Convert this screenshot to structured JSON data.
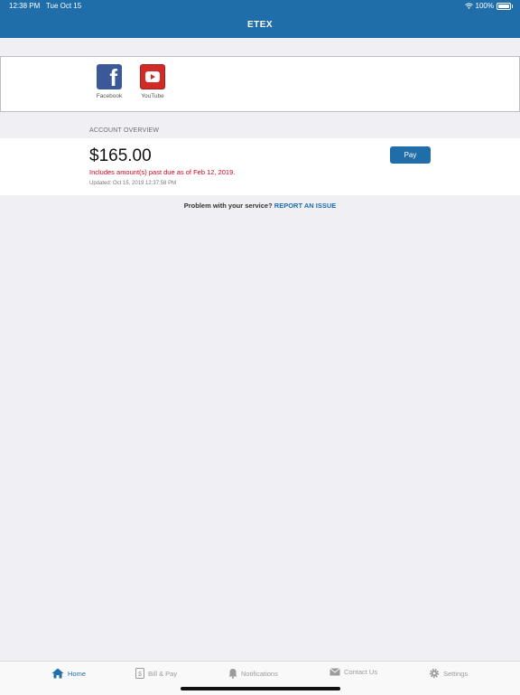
{
  "status": {
    "time": "12:38 PM",
    "date": "Tue Oct 15",
    "battery": "100%"
  },
  "app": {
    "title": "ETEX"
  },
  "social": [
    {
      "label": "Facebook",
      "icon": "facebook-icon"
    },
    {
      "label": "YouTube",
      "icon": "youtube-icon"
    }
  ],
  "account": {
    "section_label": "ACCOUNT OVERVIEW",
    "balance": "$165.00",
    "past_due": "Includes amount(s) past due as of Feb 12, 2019.",
    "updated": "Updated: Oct 15, 2019 12:37:58 PM",
    "pay_label": "Pay"
  },
  "problem": {
    "text": "Problem with your service?",
    "link": "REPORT AN ISSUE"
  },
  "tabs": [
    {
      "label": "Home",
      "icon": "home-icon",
      "active": true
    },
    {
      "label": "Bill & Pay",
      "icon": "bill-icon",
      "active": false
    },
    {
      "label": "Notifications",
      "icon": "bell-icon",
      "active": false
    },
    {
      "label": "Contact Us",
      "icon": "envelope-icon",
      "active": false
    },
    {
      "label": "Settings",
      "icon": "gear-icon",
      "active": false
    }
  ],
  "colors": {
    "brand": "#1f6eaa",
    "alert": "#d0021b",
    "background": "#efeff4"
  }
}
